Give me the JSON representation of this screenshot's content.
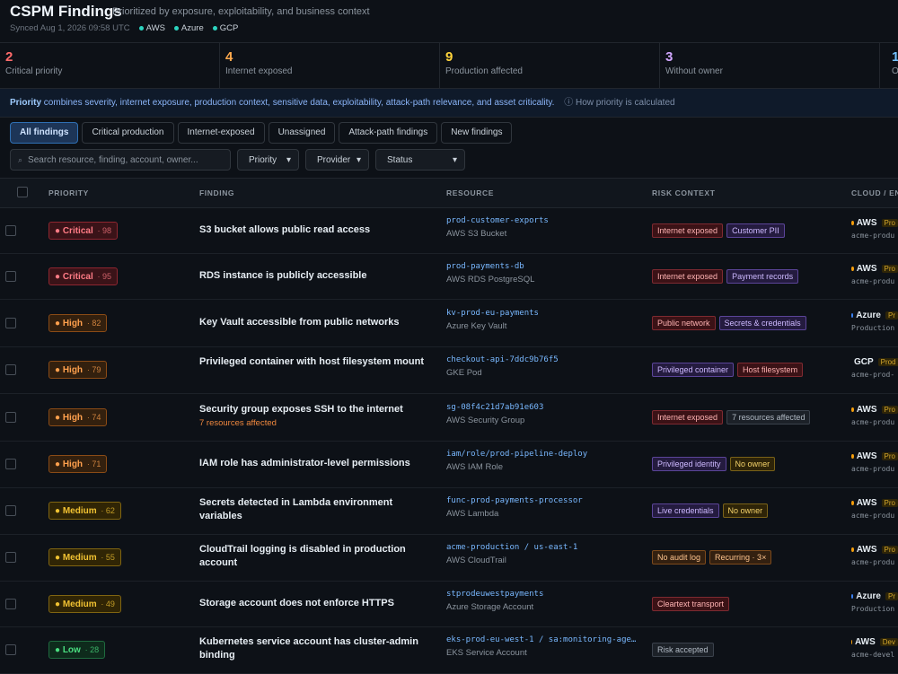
{
  "header": {
    "title": "CSPM Findings",
    "subtitle": "Prioritized by exposure, exploitability, and business context",
    "synced": "Synced Aug 1, 2026 09:58 UTC",
    "clouds": [
      "AWS",
      "Azure",
      "GCP"
    ]
  },
  "stats": [
    {
      "value": "2",
      "label": "Critical priority",
      "color": "#ff6b6b"
    },
    {
      "value": "4",
      "label": "Internet exposed",
      "color": "#ffa94d"
    },
    {
      "value": "9",
      "label": "Production affected",
      "color": "#ffd43b"
    },
    {
      "value": "3",
      "label": "Without owner",
      "color": "#d0a6ff"
    },
    {
      "value": "1",
      "label": "Ov",
      "color": "#74c0fc"
    }
  ],
  "info": {
    "lead": "Priority",
    "text": "combines severity, internet exposure, production context, sensitive data, exploitability, attack-path relevance, and asset criticality.",
    "link": "How priority is calculated"
  },
  "tabs": [
    "All findings",
    "Critical production",
    "Internet-exposed",
    "Unassigned",
    "Attack-path findings",
    "New findings"
  ],
  "filters": {
    "search_placeholder": "Search resource, finding, account, owner...",
    "priority": "Priority",
    "provider": "Provider",
    "status": "Status"
  },
  "columns": {
    "priority": "PRIORITY",
    "finding": "FINDING",
    "resource": "RESOURCE",
    "risk": "RISK CONTEXT",
    "cloud": "CLOUD / EN"
  },
  "rows": [
    {
      "severity": "Critical",
      "score": "· 98",
      "finding": "S3 bucket allows public read access",
      "finding_sub": "",
      "resource": "prod-customer-exports",
      "resource_type": "AWS S3 Bucket",
      "tags": [
        {
          "text": "Internet exposed",
          "style": "red"
        },
        {
          "text": "Customer PII",
          "style": "purple"
        }
      ],
      "cloud": "AWS",
      "env": "Pro",
      "account": "acme-produ"
    },
    {
      "severity": "Critical",
      "score": "· 95",
      "finding": "RDS instance is publicly accessible",
      "finding_sub": "",
      "resource": "prod-payments-db",
      "resource_type": "AWS RDS PostgreSQL",
      "tags": [
        {
          "text": "Internet exposed",
          "style": "red"
        },
        {
          "text": "Payment records",
          "style": "purple"
        }
      ],
      "cloud": "AWS",
      "env": "Pro",
      "account": "acme-produ"
    },
    {
      "severity": "High",
      "score": "· 82",
      "finding": "Key Vault accessible from public networks",
      "finding_sub": "",
      "resource": "kv-prod-eu-payments",
      "resource_type": "Azure Key Vault",
      "tags": [
        {
          "text": "Public network",
          "style": "red"
        },
        {
          "text": "Secrets & credentials",
          "style": "purple"
        }
      ],
      "cloud": "Azure",
      "env": "Pr",
      "account": "Production"
    },
    {
      "severity": "High",
      "score": "· 79",
      "finding": "Privileged container with host filesystem mount",
      "finding_sub": "",
      "resource": "checkout-api-7ddc9b76f5",
      "resource_type": "GKE Pod",
      "tags": [
        {
          "text": "Privileged container",
          "style": "purple"
        },
        {
          "text": "Host filesystem",
          "style": "red"
        }
      ],
      "cloud": "GCP",
      "env": "Prod",
      "account": "acme-prod-"
    },
    {
      "severity": "High",
      "score": "· 74",
      "finding": "Security group exposes SSH to the internet",
      "finding_sub": "7 resources affected",
      "resource": "sg-08f4c21d7ab91e603",
      "resource_type": "AWS Security Group",
      "tags": [
        {
          "text": "Internet exposed",
          "style": "red"
        },
        {
          "text": "7 resources affected",
          "style": "gray"
        }
      ],
      "cloud": "AWS",
      "env": "Pro",
      "account": "acme-produ"
    },
    {
      "severity": "High",
      "score": "· 71",
      "finding": "IAM role has administrator-level permissions",
      "finding_sub": "",
      "resource": "iam/role/prod-pipeline-deploy",
      "resource_type": "AWS IAM Role",
      "tags": [
        {
          "text": "Privileged identity",
          "style": "purple"
        },
        {
          "text": "No owner",
          "style": "yellow"
        }
      ],
      "cloud": "AWS",
      "env": "Pro",
      "account": "acme-produ"
    },
    {
      "severity": "Medium",
      "score": "· 62",
      "finding": "Secrets detected in Lambda environment variables",
      "finding_sub": "",
      "resource": "func-prod-payments-processor",
      "resource_type": "AWS Lambda",
      "tags": [
        {
          "text": "Live credentials",
          "style": "purple"
        },
        {
          "text": "No owner",
          "style": "yellow"
        }
      ],
      "cloud": "AWS",
      "env": "Pro",
      "account": "acme-produ"
    },
    {
      "severity": "Medium",
      "score": "· 55",
      "finding": "CloudTrail logging is disabled in production account",
      "finding_sub": "",
      "resource": "acme-production / us-east-1",
      "resource_type": "AWS CloudTrail",
      "tags": [
        {
          "text": "No audit log",
          "style": "orange"
        },
        {
          "text": "Recurring · 3×",
          "style": "orange"
        }
      ],
      "cloud": "AWS",
      "env": "Pro",
      "account": "acme-produ"
    },
    {
      "severity": "Medium",
      "score": "· 49",
      "finding": "Storage account does not enforce HTTPS",
      "finding_sub": "",
      "resource": "stprodeuwestpayments",
      "resource_type": "Azure Storage Account",
      "tags": [
        {
          "text": "Cleartext transport",
          "style": "red"
        }
      ],
      "cloud": "Azure",
      "env": "Pr",
      "account": "Production"
    },
    {
      "severity": "Low",
      "score": "· 28",
      "finding": "Kubernetes service account has cluster-admin binding",
      "finding_sub": "",
      "resource": "eks-prod-eu-west-1 / sa:monitoring-age…",
      "resource_type": "EKS Service Account",
      "tags": [
        {
          "text": "Risk accepted",
          "style": "gray"
        }
      ],
      "cloud": "AWS",
      "env": "Dev",
      "account": "acme-devel"
    }
  ],
  "colors": {
    "aws": "#f59e0b",
    "azure": "#3b82f6",
    "gcp": "#22c55e",
    "synced_dot": "#2dd4bf"
  }
}
